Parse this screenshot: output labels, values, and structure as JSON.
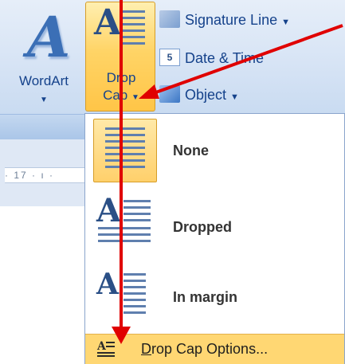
{
  "ribbon": {
    "wordart_label": "WordArt",
    "wordart_glyph": "A",
    "dropcap_line1": "Drop",
    "dropcap_line2": "Cap",
    "dropcap_glyph": "A",
    "signature_line_label": "Signature Line",
    "date_time_label": "Date & Time",
    "object_label": "Object",
    "date_time_icon_text": "5"
  },
  "ruler": {
    "text": "· 17 · ı ·"
  },
  "menu": {
    "items": [
      {
        "label": "None",
        "selected": true
      },
      {
        "label": "Dropped",
        "selected": false
      },
      {
        "label": "In margin",
        "selected": false
      }
    ],
    "footer_label": "Drop Cap Options...",
    "footer_mnemonic": "D"
  },
  "annotation": {
    "arrow_color": "#e00000"
  },
  "icons": [
    "wordart-icon",
    "drop-cap-icon",
    "signature-line-icon",
    "date-time-icon",
    "object-icon",
    "drop-cap-options-icon"
  ]
}
